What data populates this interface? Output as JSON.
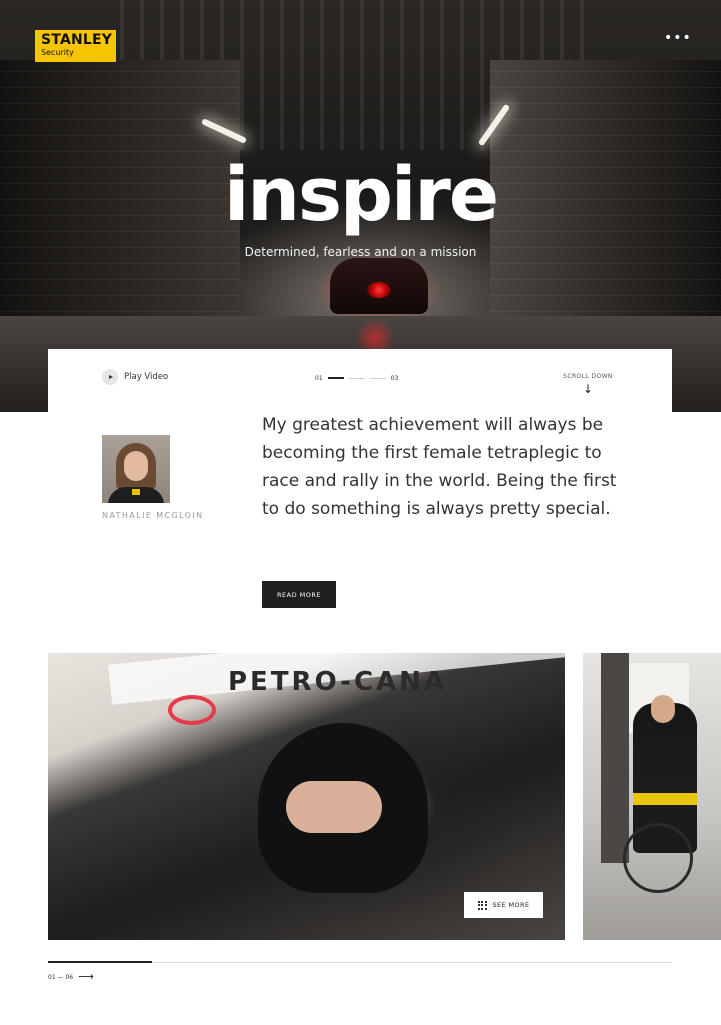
{
  "brand": {
    "logo_name": "STANLEY",
    "logo_sub": "Security",
    "logo_color": "#f6c500"
  },
  "header": {
    "menu_icon": "ellipsis-icon",
    "menu_glyph": "•••"
  },
  "hero": {
    "title": "inspire",
    "subtitle": "Determined, fearless and on a mission"
  },
  "controls": {
    "play_label": "Play Video",
    "pager_start": "01",
    "pager_end": "03",
    "pager_current": 1,
    "pager_total": 3,
    "scroll_label": "SCROLL DOWN",
    "scroll_arrow": "↓"
  },
  "quote": {
    "person_name": "NATHALIE MCGLOIN",
    "text": "My greatest achievement will always be becoming the first female tetraplegic to race and rally in the world. Being the first to do something is always pretty special.",
    "cta_label": "READ MORE"
  },
  "gallery": {
    "main_card_text": "PETRO-CANA",
    "see_more_label": "SEE MORE",
    "counter_label": "01 — 06",
    "counter_arrow": "⟶",
    "current": 1,
    "total": 6
  }
}
